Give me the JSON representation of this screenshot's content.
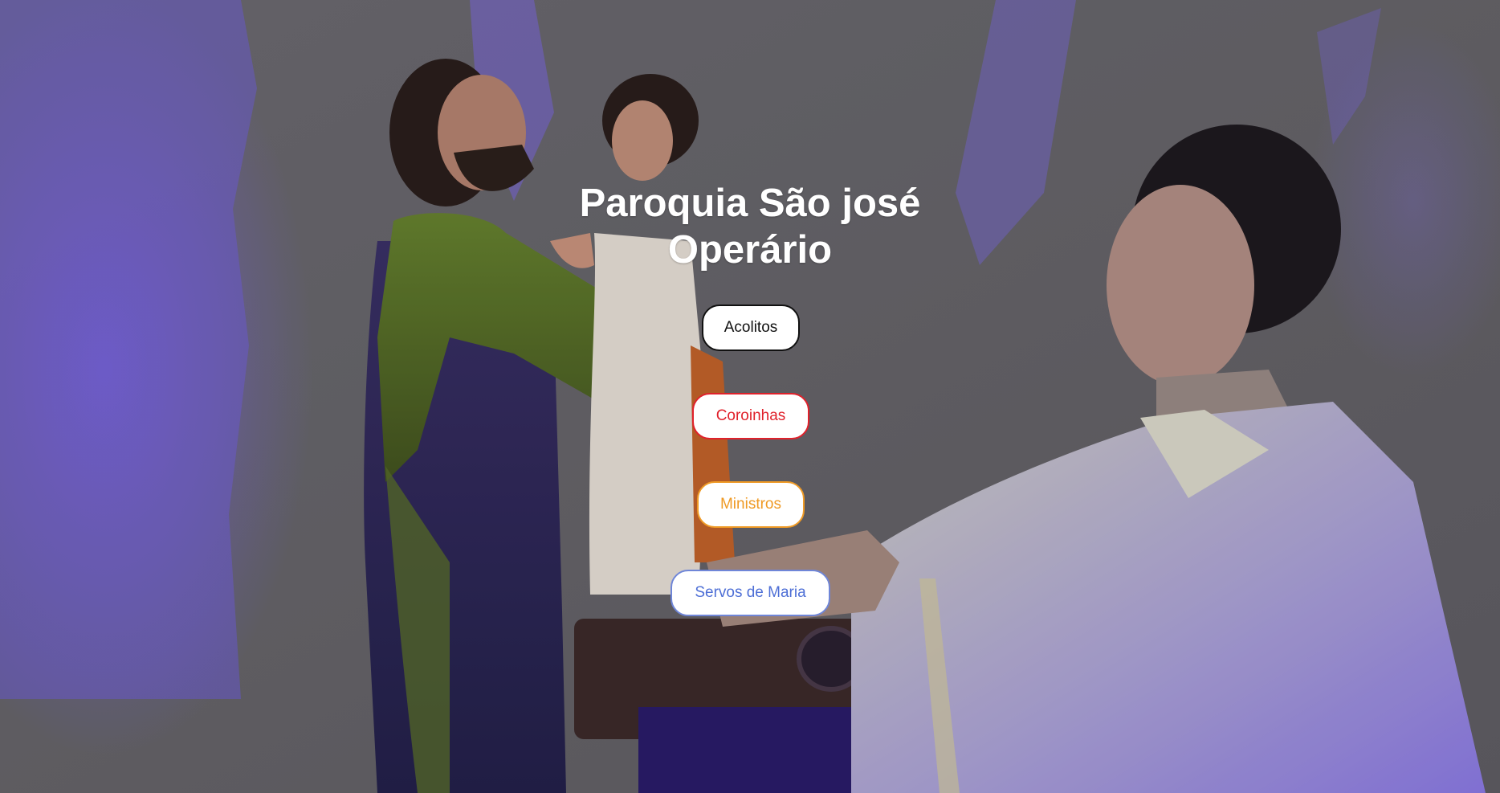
{
  "page": {
    "title": "Paroquia São josé Operário"
  },
  "background": {
    "image_subject": "statue-and-priest-photo",
    "accent_light": "#7b5cf0"
  },
  "nav": {
    "buttons": [
      {
        "label": "Acolitos",
        "color": "#111111"
      },
      {
        "label": "Coroinhas",
        "color": "#e0212b"
      },
      {
        "label": "Ministros",
        "color": "#ef9a25"
      },
      {
        "label": "Servos de Maria",
        "color": "#4e6fd6"
      }
    ]
  }
}
